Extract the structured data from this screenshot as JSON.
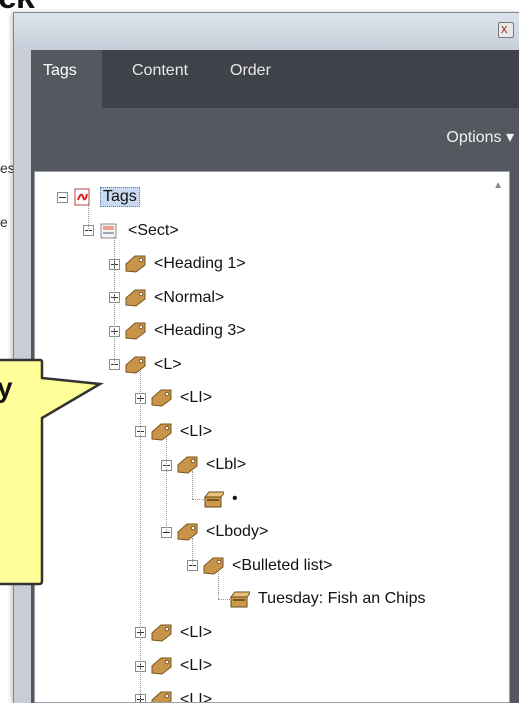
{
  "background": {
    "heading_fragment": "ek",
    "text_fragment_1": "es",
    "text_fragment_2": "e",
    "callout_fragment": "y"
  },
  "panel": {
    "close_label": "x",
    "tabs": [
      {
        "label": "Tags",
        "active": true
      },
      {
        "label": "Content",
        "active": false
      },
      {
        "label": "Order",
        "active": false
      }
    ],
    "options_label": "Options",
    "options_arrow": "▾"
  },
  "tree": [
    {
      "label": "Tags",
      "icon": "pdf-tags-icon",
      "expander": "minus",
      "selected": true
    },
    {
      "label": "<Sect>",
      "icon": "section-icon",
      "expander": "minus"
    },
    {
      "label": "<Heading 1>",
      "icon": "tag-icon",
      "expander": "plus"
    },
    {
      "label": "<Normal>",
      "icon": "tag-icon",
      "expander": "plus"
    },
    {
      "label": "<Heading 3>",
      "icon": "tag-icon",
      "expander": "plus"
    },
    {
      "label": "<L>",
      "icon": "tag-icon",
      "expander": "minus"
    },
    {
      "label": "<LI>",
      "icon": "tag-icon",
      "expander": "plus"
    },
    {
      "label": "<LI>",
      "icon": "tag-icon",
      "expander": "minus"
    },
    {
      "label": "<Lbl>",
      "icon": "tag-icon",
      "expander": "minus"
    },
    {
      "label": "•",
      "icon": "content-box-icon",
      "expander": "none"
    },
    {
      "label": "<Lbody>",
      "icon": "tag-icon",
      "expander": "minus"
    },
    {
      "label": "<Bulleted list>",
      "icon": "tag-icon",
      "expander": "minus"
    },
    {
      "label": "Tuesday: Fish an Chips",
      "icon": "content-box-icon",
      "expander": "none"
    },
    {
      "label": "<LI>",
      "icon": "tag-icon",
      "expander": "plus"
    },
    {
      "label": "<LI>",
      "icon": "tag-icon",
      "expander": "plus"
    },
    {
      "label": "<LI>",
      "icon": "tag-icon",
      "expander": "plus"
    }
  ],
  "colors": {
    "tab_bar": "#3f4349",
    "panel_bg": "#55595f",
    "callout_fill": "#ffff99",
    "callout_border": "#333333",
    "tag_icon": "#c8944a"
  }
}
